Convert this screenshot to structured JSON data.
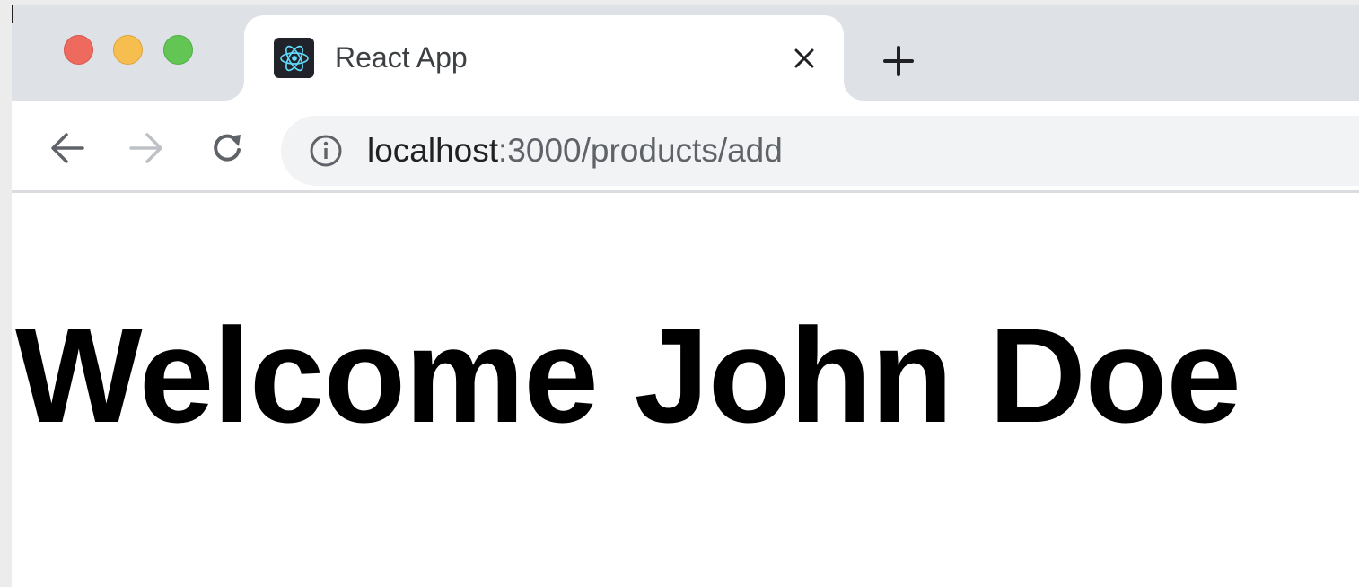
{
  "window": {
    "controls": {
      "close_color": "#ee6a5f",
      "minimize_color": "#f5be4f",
      "maximize_color": "#62c554"
    }
  },
  "tab": {
    "title": "React App",
    "favicon": "react-logo-icon",
    "close_icon": "close-icon"
  },
  "new_tab": {
    "icon": "plus-icon"
  },
  "toolbar": {
    "back_icon": "arrow-left-icon",
    "forward_icon": "arrow-right-icon",
    "reload_icon": "reload-icon",
    "forward_enabled": false
  },
  "address_bar": {
    "info_icon": "info-icon",
    "host": "localhost",
    "path": ":3000/products/add"
  },
  "page": {
    "heading": "Welcome John Doe"
  }
}
